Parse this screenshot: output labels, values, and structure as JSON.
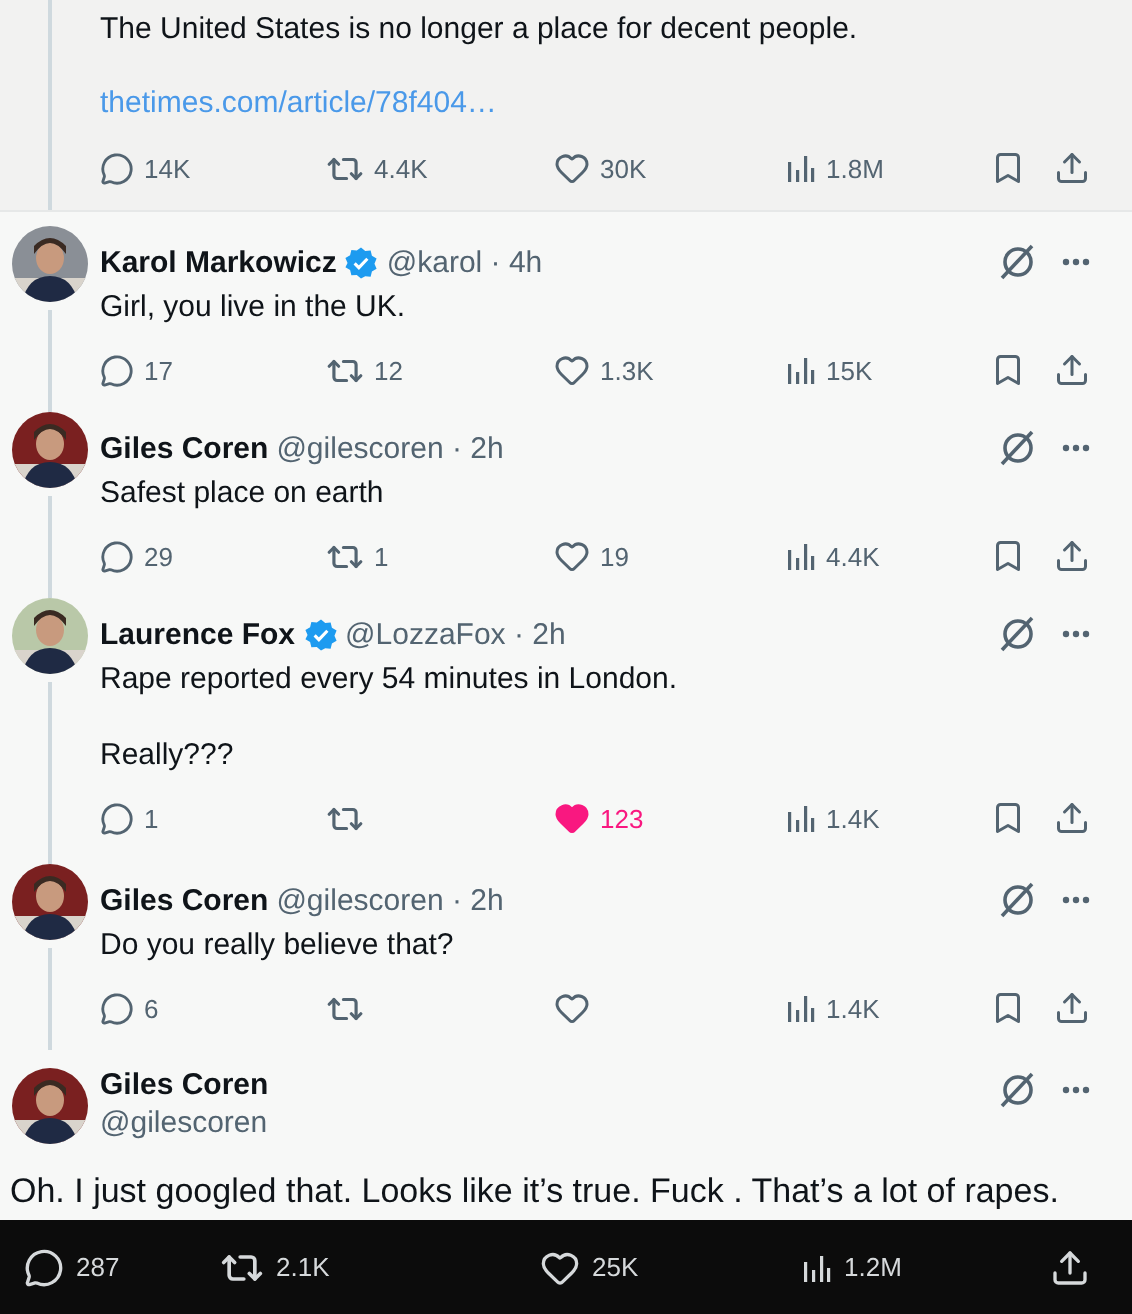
{
  "quoted_post": {
    "text": "The United States is no longer a place for decent people.",
    "link": "thetimes.com/article/78f404…",
    "stats": {
      "replies": "14K",
      "reposts": "4.4K",
      "likes": "30K",
      "liked": false,
      "views": "1.8M"
    }
  },
  "replies": [
    {
      "name": "Karol Markowicz",
      "verified": true,
      "handle": "@karol · 4h",
      "text": "Girl, you live in the UK.",
      "stats": {
        "replies": "17",
        "reposts": "12",
        "likes": "1.3K",
        "liked": false,
        "views": "15K"
      }
    },
    {
      "name": "Giles Coren",
      "verified": false,
      "handle": "@gilescoren · 2h",
      "text": "Safest place on earth",
      "stats": {
        "replies": "29",
        "reposts": "1",
        "likes": "19",
        "liked": false,
        "views": "4.4K"
      }
    },
    {
      "name": "Laurence Fox",
      "verified": true,
      "handle": "@LozzaFox · 2h",
      "text": "Rape reported every 54 minutes in London.\n\nReally???",
      "stats": {
        "replies": "1",
        "liked": true,
        "likes": "123",
        "views": "1.4K"
      }
    },
    {
      "name": "Giles Coren",
      "verified": false,
      "handle": "@gilescoren · 2h",
      "text": "Do you really believe that?",
      "stats": {
        "replies": "6",
        "liked": false,
        "views": "1.4K"
      }
    }
  ],
  "focused_post": {
    "name": "Giles Coren",
    "handle": "@gilescoren",
    "text": "Oh. I just googled that. Looks like it’s true. Fuck . That’s a lot of rapes.",
    "stats": {
      "replies": "287",
      "reposts": "2.1K",
      "likes": "25K",
      "views": "1.2M"
    }
  }
}
